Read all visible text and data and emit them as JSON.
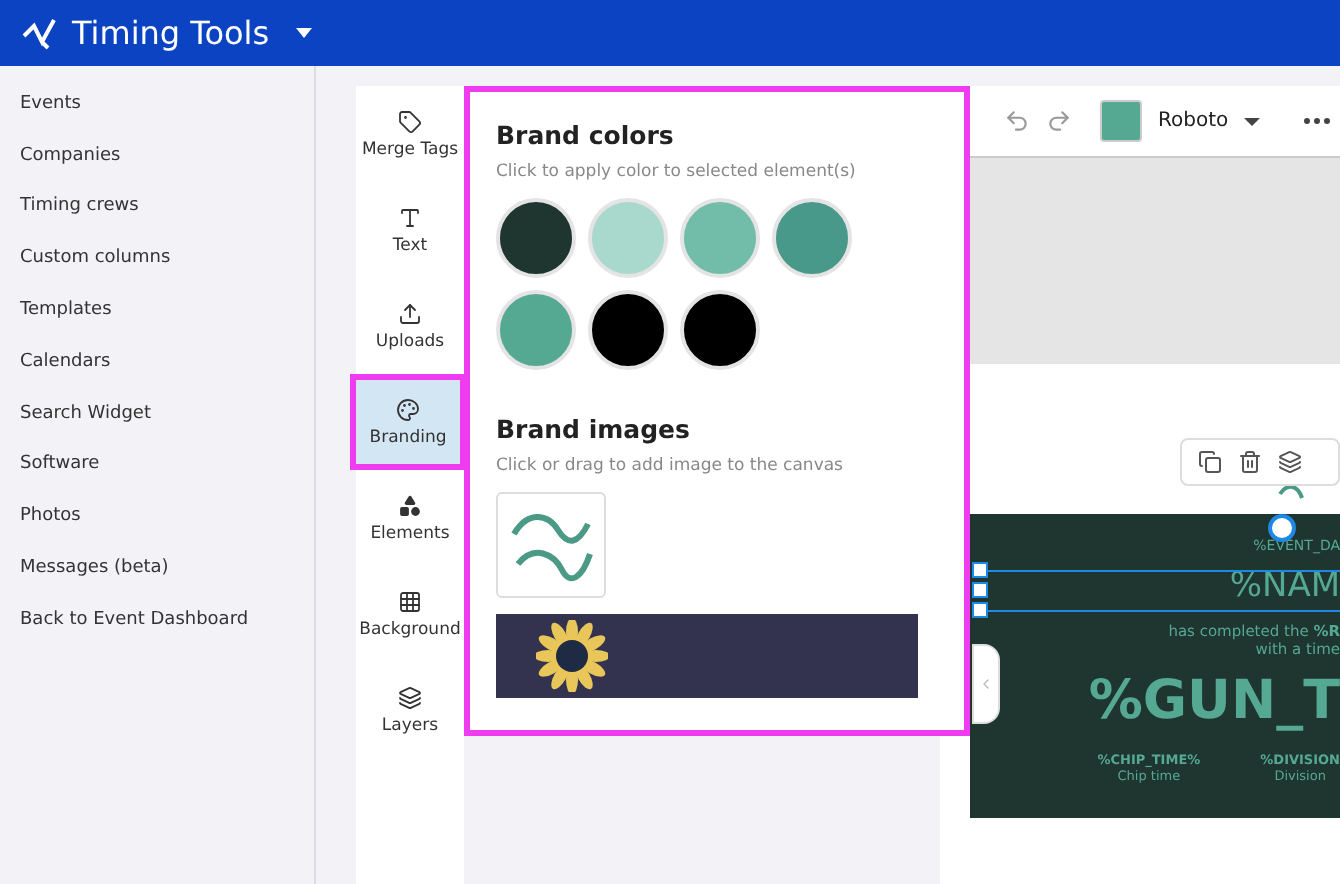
{
  "header": {
    "title": "Timing Tools"
  },
  "sidebar": {
    "items": [
      {
        "label": "Events"
      },
      {
        "label": "Companies"
      },
      {
        "label": "Timing crews"
      },
      {
        "label": "Custom columns"
      },
      {
        "label": "Templates"
      },
      {
        "label": "Calendars"
      },
      {
        "label": "Search Widget"
      },
      {
        "label": "Software"
      },
      {
        "label": "Photos"
      },
      {
        "label": "Messages (beta)"
      },
      {
        "label": "Back to Event Dashboard"
      }
    ]
  },
  "rail": {
    "items": [
      {
        "kind": "tag",
        "label": "Merge Tags",
        "selected": false
      },
      {
        "kind": "text",
        "label": "Text",
        "selected": false
      },
      {
        "kind": "upload",
        "label": "Uploads",
        "selected": false
      },
      {
        "kind": "palette",
        "label": "Branding",
        "selected": true
      },
      {
        "kind": "shapes",
        "label": "Elements",
        "selected": false
      },
      {
        "kind": "grid",
        "label": "Background",
        "selected": false
      },
      {
        "kind": "layers",
        "label": "Layers",
        "selected": false
      }
    ]
  },
  "panel": {
    "colors_title": "Brand colors",
    "colors_hint": "Click to apply color to selected element(s)",
    "colors": [
      {
        "color": "#1e3530"
      },
      {
        "color": "#a9d9cc"
      },
      {
        "color": "#72bcaa"
      },
      {
        "color": "#48998a"
      },
      {
        "color": "#55a891"
      },
      {
        "color": "#000000"
      },
      {
        "color": "#000000"
      }
    ],
    "images_title": "Brand images",
    "images_hint": "Click or drag to add image to the canvas",
    "images": [
      {
        "kind": "lettering"
      },
      {
        "kind": "banner"
      }
    ]
  },
  "toolbar": {
    "swatch": {
      "color": "#55a891"
    },
    "font": "Roboto"
  },
  "canvas": {
    "event_date": "%EVENT_DA",
    "name": "%NAM",
    "completed": "has completed the **%R**",
    "with_time": "with a time",
    "gun_time": "%GUN_T",
    "stats": [
      {
        "value": "%CHIP_TIME%",
        "label": "Chip time"
      },
      {
        "value": "%DIVISION",
        "label": "Division"
      }
    ]
  }
}
